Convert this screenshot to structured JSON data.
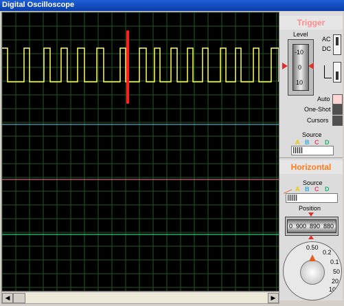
{
  "window": {
    "title": "Digital Oscilloscope"
  },
  "trigger": {
    "heading": "Trigger",
    "level_label": "Level",
    "level_ticks": [
      "-10",
      "0",
      "10"
    ],
    "coupling": [
      "AC",
      "DC"
    ],
    "buttons": [
      "Auto",
      "One-Shot",
      "Cursors"
    ],
    "source_label": "Source",
    "source_channels": [
      "A",
      "B",
      "C",
      "D"
    ]
  },
  "horizontal": {
    "heading": "Horizontal",
    "source_label": "Source",
    "source_channels": [
      "A",
      "B",
      "C",
      "D"
    ],
    "position_label": "Position",
    "position_ticks": [
      "0",
      "900",
      "890",
      "880"
    ],
    "dial_ticks": [
      "0.50",
      "0.2",
      "0.1",
      "50",
      "20",
      "10"
    ]
  },
  "colors": {
    "trigger_heading": "#ff8c8c",
    "horizontal_heading": "#ff7a1a",
    "trace_a": "#ffff66",
    "trace_b": "#66ccee",
    "trace_c": "#ff7f8f",
    "trace_d": "#33ff99",
    "marker": "#ff2020"
  }
}
